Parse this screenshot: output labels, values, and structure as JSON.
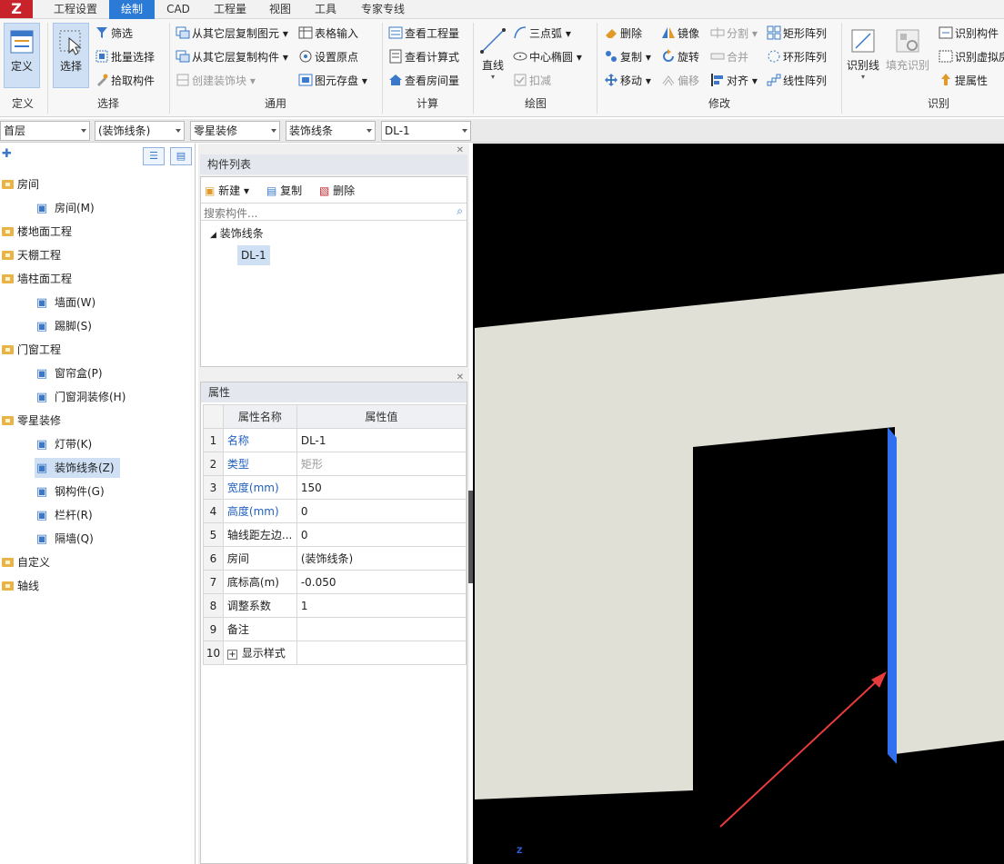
{
  "menu": {
    "tabs": [
      "工程设置",
      "绘制",
      "CAD",
      "工程量",
      "视图",
      "工具",
      "专家专线"
    ],
    "active": 1
  },
  "ribbon": {
    "groups": [
      "定义",
      "选择",
      "通用",
      "计算",
      "绘图",
      "修改",
      "识别"
    ],
    "define": {
      "define": "定义"
    },
    "select": {
      "select": "选择",
      "filter": "筛选",
      "batch": "批量选择",
      "pick": "拾取构件"
    },
    "common": {
      "copy_from_floor": "从其它层复制图元",
      "copy_comp": "从其它层复制构件",
      "create_deco": "创建装饰块",
      "table_input": "表格输入",
      "set_origin": "设置原点",
      "save_element": "图元存盘"
    },
    "calc": {
      "view_qty": "查看工程量",
      "view_formula": "查看计算式",
      "view_room": "查看房间量"
    },
    "draw": {
      "line": "直线",
      "arc3": "三点弧",
      "center_ellipse": "中心椭圆",
      "deduct": "扣减"
    },
    "modify": {
      "delete": "删除",
      "copy": "复制",
      "move": "移动",
      "mirror": "镜像",
      "rotate": "旋转",
      "offset": "偏移",
      "split": "分割",
      "merge": "合并",
      "align": "对齐",
      "rect_array": "矩形阵列",
      "ring_array": "环形阵列",
      "linear_array": "线性阵列"
    },
    "recognize": {
      "recog_line": "识别线",
      "fill_recog": "填充识别",
      "recog_comp": "识别构件",
      "recog_virtual": "识别虚拟房",
      "extract_attr": "提属性"
    }
  },
  "selectors": {
    "floor": "首层",
    "room": "(装饰线条)",
    "category": "零星装修",
    "type": "装饰线条",
    "component": "DL-1"
  },
  "tree": {
    "items": [
      {
        "label": "房间",
        "level": 0
      },
      {
        "label": "房间(M)",
        "level": 1
      },
      {
        "label": "楼地面工程",
        "level": 0
      },
      {
        "label": "天棚工程",
        "level": 0
      },
      {
        "label": "墙柱面工程",
        "level": 0
      },
      {
        "label": "墙面(W)",
        "level": 1
      },
      {
        "label": "踢脚(S)",
        "level": 1
      },
      {
        "label": "门窗工程",
        "level": 0
      },
      {
        "label": "窗帘盒(P)",
        "level": 1
      },
      {
        "label": "门窗洞装修(H)",
        "level": 1
      },
      {
        "label": "零星装修",
        "level": 0
      },
      {
        "label": "灯带(K)",
        "level": 1
      },
      {
        "label": "装饰线条(Z)",
        "level": 1
      },
      {
        "label": "钢构件(G)",
        "level": 1
      },
      {
        "label": "栏杆(R)",
        "level": 1
      },
      {
        "label": "隔墙(Q)",
        "level": 1
      },
      {
        "label": "自定义",
        "level": 0
      },
      {
        "label": "轴线",
        "level": 0
      }
    ],
    "selected_index": 12
  },
  "component_list": {
    "title": "构件列表",
    "new": "新建",
    "copy": "复制",
    "delete": "删除",
    "search_placeholder": "搜索构件...",
    "group": "装饰线条",
    "item": "DL-1"
  },
  "properties": {
    "title": "属性",
    "col_name": "属性名称",
    "col_value": "属性值",
    "rows": [
      {
        "n": "1",
        "name": "名称",
        "value": "DL-1"
      },
      {
        "n": "2",
        "name": "类型",
        "value": "矩形"
      },
      {
        "n": "3",
        "name": "宽度(mm)",
        "value": "150"
      },
      {
        "n": "4",
        "name": "高度(mm)",
        "value": "0"
      },
      {
        "n": "5",
        "name": "轴线距左边...",
        "value": "0"
      },
      {
        "n": "6",
        "name": "房间",
        "value": "(装饰线条)"
      },
      {
        "n": "7",
        "name": "底标高(m)",
        "value": "-0.050"
      },
      {
        "n": "8",
        "name": "调整系数",
        "value": "1"
      },
      {
        "n": "9",
        "name": "备注",
        "value": ""
      },
      {
        "n": "10",
        "name": "显示样式",
        "value": ""
      }
    ]
  },
  "viewport": {
    "axis": "Z",
    "wall_color": "#e0e0d6",
    "strip_color": "#2f6ff0",
    "arrow_color": "#e83c3c"
  }
}
